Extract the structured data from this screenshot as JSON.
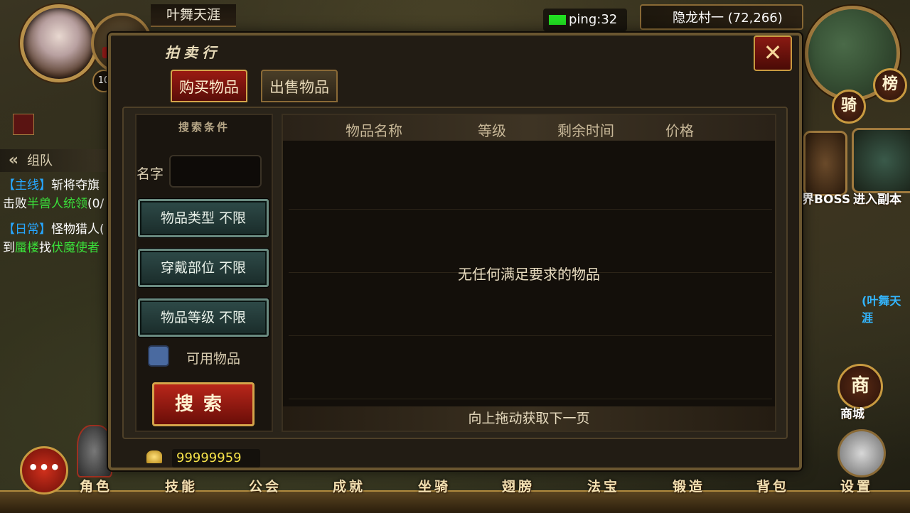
{
  "player": {
    "name": "叶舞天涯",
    "level": "10"
  },
  "status": {
    "ping": "ping:32",
    "location": "隐龙村一 (72,266)"
  },
  "right_buttons": {
    "rank": "榜",
    "ride": "骑",
    "boss": "界BOSS",
    "dungeon": "进入副本",
    "shop": "商城",
    "shop_icon": "商",
    "settings": "设置"
  },
  "quests": {
    "team_label": "组队",
    "chevron": "«",
    "items": [
      {
        "tag": "【主线】",
        "title": "斩将夺旗"
      },
      {
        "pre": "击败",
        "target": "半兽人统领",
        "post": "(0/"
      },
      {
        "tag": "【日常】",
        "title": "怪物猎人("
      },
      {
        "pre": "到",
        "target": "蜃楼",
        "mid": "找",
        "target2": "伏魔使者"
      }
    ]
  },
  "world_name": "(叶舞天涯",
  "dialog": {
    "title": "拍卖行",
    "close": "✕",
    "tabs": [
      {
        "label": "购买物品",
        "active": true
      },
      {
        "label": "出售物品",
        "active": false
      }
    ],
    "filter": {
      "title": "搜索条件",
      "name_label": "名字",
      "name_value": "",
      "selects": [
        {
          "label": "物品类型 不限"
        },
        {
          "label": "穿戴部位 不限"
        },
        {
          "label": "物品等级 不限"
        }
      ],
      "usable_label": "可用物品",
      "usable_checked": false,
      "search_label": "搜索"
    },
    "list": {
      "columns": [
        "物品名称",
        "等级",
        "剩余时间",
        "价格"
      ],
      "empty_message": "无任何满足要求的物品",
      "next_page": "向上拖动获取下一页"
    },
    "gold": "99999959"
  },
  "bottom_menu": [
    "角色",
    "技能",
    "公会",
    "成就",
    "坐骑",
    "翅膀",
    "法宝",
    "锻造",
    "背包"
  ],
  "chat_icon": "•••",
  "colors": {
    "accent_red": "#9a1a12",
    "gold_border": "#d4a44a",
    "quest_tag": "#27a7ff",
    "quest_target": "#3adf3a",
    "gold_text": "#f6e24a",
    "ping_ok": "#22e022"
  }
}
